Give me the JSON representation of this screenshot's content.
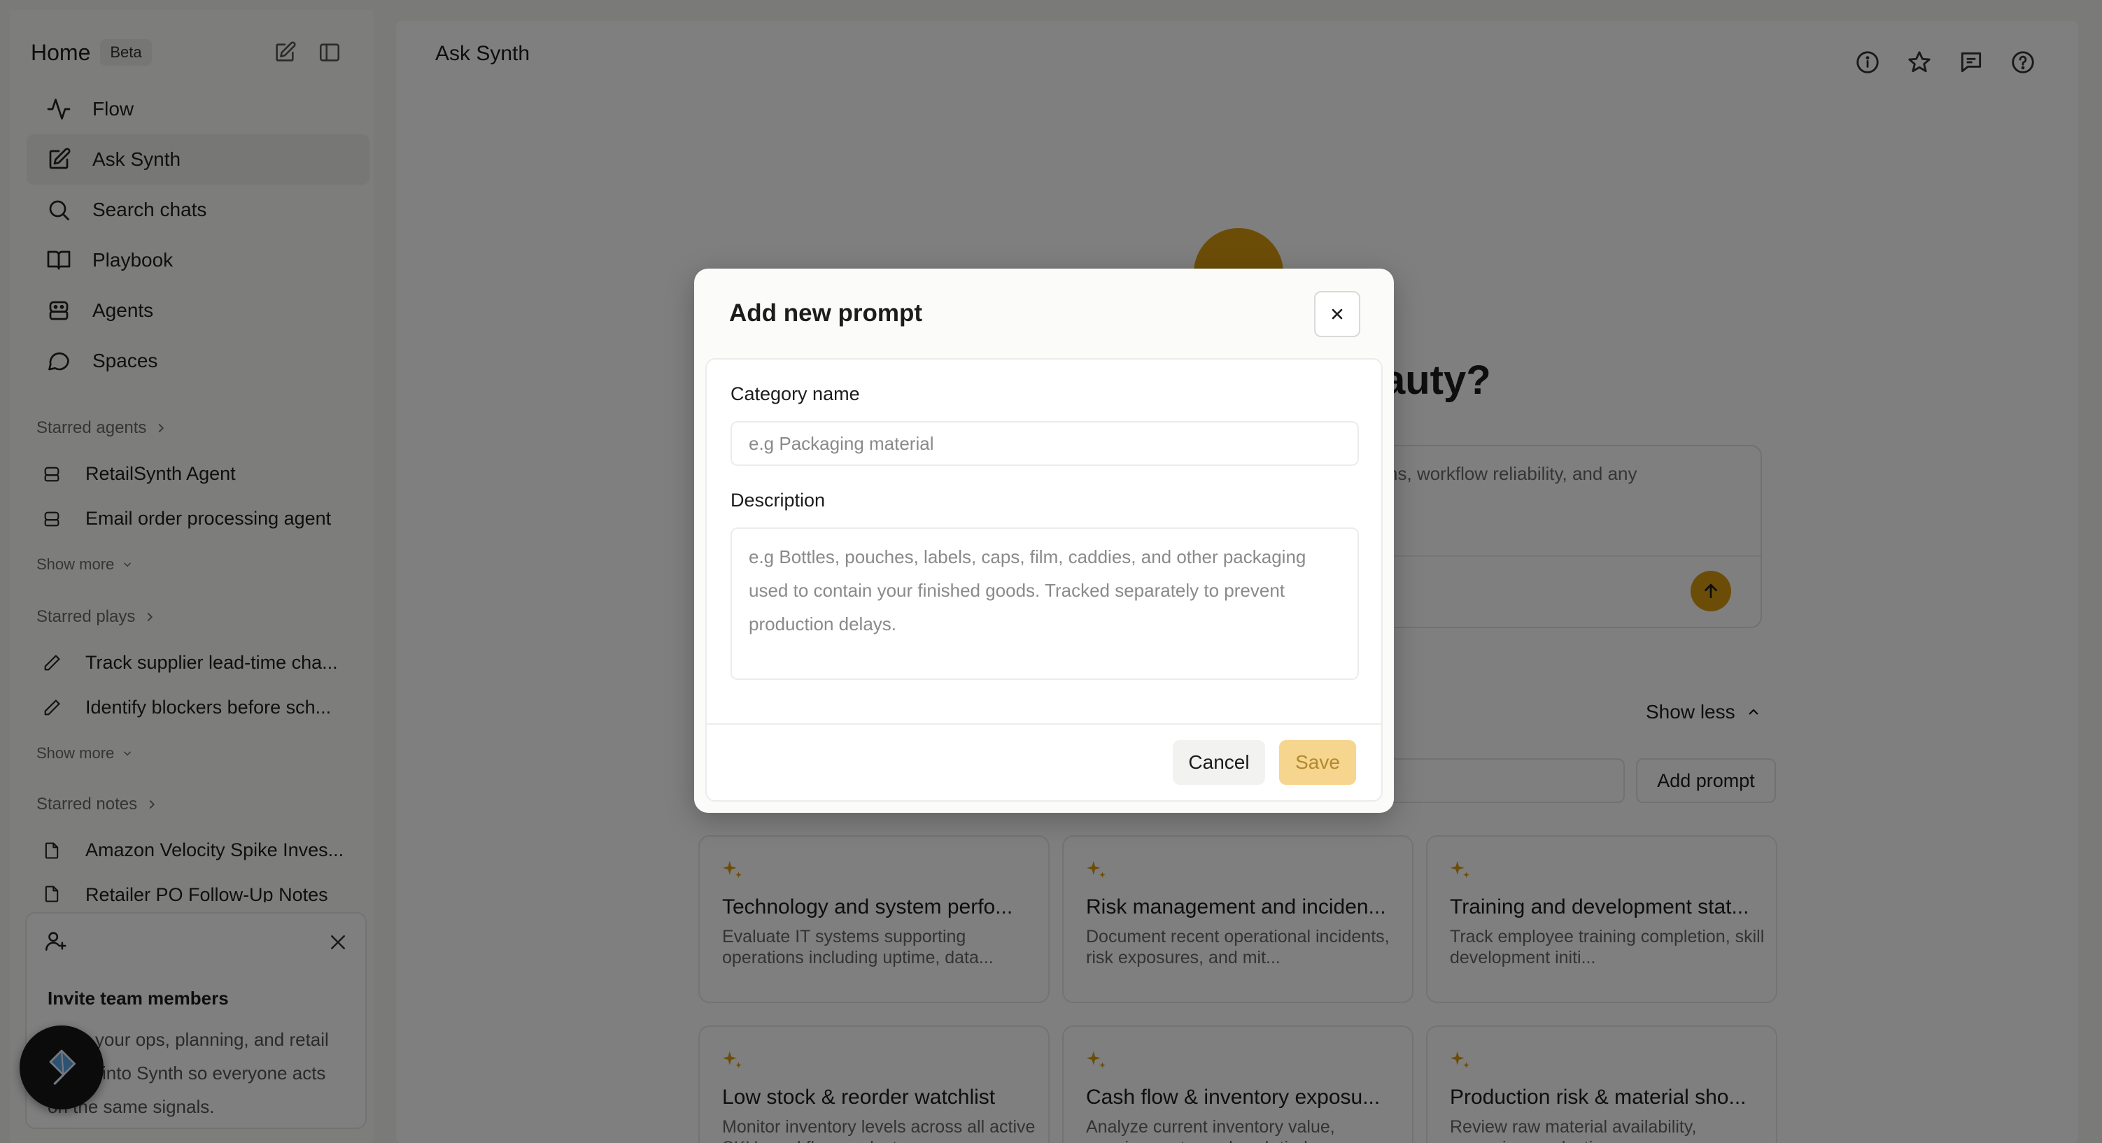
{
  "sidebar": {
    "home_label": "Home",
    "beta_badge": "Beta",
    "nav": [
      {
        "label": "Flow",
        "icon": "activity-icon"
      },
      {
        "label": "Ask Synth",
        "icon": "edit-icon"
      },
      {
        "label": "Search chats",
        "icon": "search-icon"
      },
      {
        "label": "Playbook",
        "icon": "book-icon"
      },
      {
        "label": "Agents",
        "icon": "agent-icon"
      },
      {
        "label": "Spaces",
        "icon": "chat-bubble-icon"
      }
    ],
    "starred_agents": {
      "title": "Starred agents",
      "items": [
        "RetailSynth Agent",
        "Email order processing agent"
      ],
      "show_more": "Show more"
    },
    "starred_plays": {
      "title": "Starred plays",
      "items": [
        "Track supplier lead-time cha...",
        "Identify blockers before sch..."
      ],
      "show_more": "Show more"
    },
    "starred_notes": {
      "title": "Starred notes",
      "items": [
        "Amazon Velocity Spike Inves...",
        "Retailer PO Follow-Up Notes"
      ]
    },
    "invite": {
      "title": "Invite team members",
      "text": "Bring your ops, planning, and retail teams into Synth so everyone acts on the same signals."
    }
  },
  "main": {
    "title": "Ask Synth",
    "hero_suffix": "auty?",
    "ask_placeholder_visible": "grations, workflow reliability, and any",
    "show_less": "Show less",
    "add_prompt": "Add prompt",
    "cards": [
      {
        "title": "Technology and system perfo...",
        "desc": "Evaluate IT systems supporting operations including uptime, data..."
      },
      {
        "title": "Risk management and inciden...",
        "desc": "Document recent operational incidents, risk exposures, and mit..."
      },
      {
        "title": "Training and development stat...",
        "desc": "Track employee training completion, skill development initi..."
      },
      {
        "title": "Low stock & reorder watchlist",
        "desc": "Monitor inventory levels across all active SKUs and flag products..."
      },
      {
        "title": "Cash flow & inventory exposu...",
        "desc": "Analyze current inventory value, carrying costs, and cash tied..."
      },
      {
        "title": "Production risk & material sho...",
        "desc": "Review raw material availability, upcoming production runs..."
      }
    ]
  },
  "modal": {
    "title": "Add new prompt",
    "category_label": "Category name",
    "category_placeholder": "e.g Packaging material",
    "description_label": "Description",
    "description_placeholder": "e.g Bottles, pouches, labels, caps, film, caddies, and other packaging used to contain your finished goods. Tracked separately to prevent production delays.",
    "cancel": "Cancel",
    "save": "Save"
  },
  "colors": {
    "accent": "#d99a10",
    "save_disabled_bg": "#f6d58e",
    "overlay": "rgba(0,0,0,0.5)"
  }
}
